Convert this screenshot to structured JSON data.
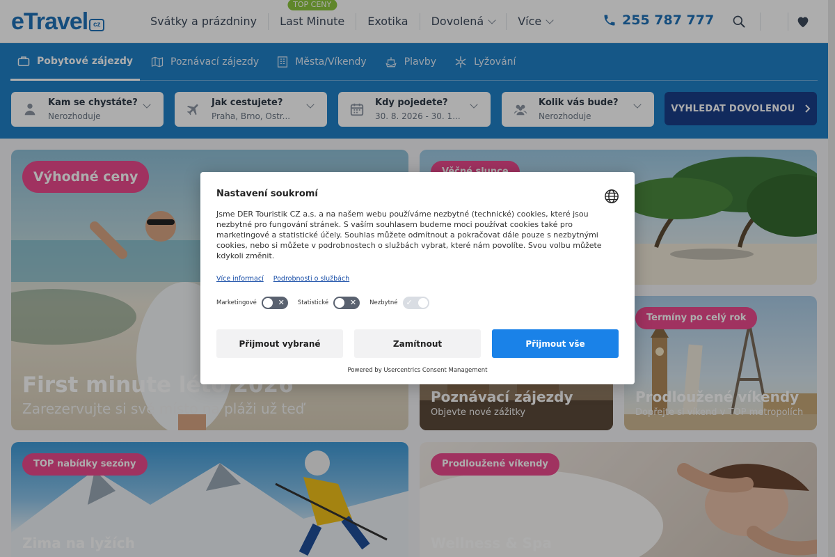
{
  "header": {
    "logo_text": "eTravel",
    "logo_suffix": "cz",
    "nav": [
      {
        "label": "Svátky a prázdniny"
      },
      {
        "label": "Last Minute",
        "badge": "TOP CENY"
      },
      {
        "label": "Exotika"
      },
      {
        "label": "Dovolená"
      },
      {
        "label": "Více"
      }
    ],
    "phone": "255 787 777",
    "icons": [
      "search-icon",
      "heart-icon"
    ]
  },
  "search_bar": {
    "tabs": [
      "Pobytové zájezdy",
      "Poznávací zájezdy",
      "Města/Víkendy",
      "Plavby",
      "Lyžování"
    ],
    "active_tab": "Pobytové zájezdy",
    "fields": [
      {
        "label": "Kam se chystáte?",
        "value": "Nerozhoduje"
      },
      {
        "label": "Jak cestujete?",
        "value": "Praha, Brno, Ostr..."
      },
      {
        "label": "Kdy pojedete?",
        "value": "30. 8. 2026 - 30. 1..."
      },
      {
        "label": "Kolik vás bude?",
        "value": "Nerozhoduje"
      }
    ],
    "search_button": "VYHLEDAT DOVOLENOU"
  },
  "tiles": [
    {
      "badge": "Výhodné ceny",
      "title": "First minute léto 2026",
      "subtitle": "Zarezervujte si své místo na pláži už teď"
    },
    {
      "badge": "Věčné slunce",
      "title": "",
      "subtitle": ""
    },
    {
      "badge": "",
      "title": "Poznávací zájezdy",
      "subtitle": "Objevte nové zážitky"
    },
    {
      "badge": "Termíny po celý rok",
      "title": "Prodloužené víkendy",
      "subtitle": "Dopřejte si víkend v TOP metropolích"
    },
    {
      "badge": "TOP nabídky sezóny",
      "title": "Zima na lyžích",
      "subtitle": ""
    },
    {
      "badge": "Prodloužené víkendy",
      "title": "Wellness & Spa",
      "subtitle": ""
    }
  ],
  "cookie_modal": {
    "title": "Nastavení soukromí",
    "text": "Jsme DER Touristik CZ a.s. a na našem webu používáme nezbytné (technické) cookies, které jsou nezbytné pro fungování stránek. S vaším souhlasem budeme moci používat cookies také pro marketingové a statistické účely. Souhlas můžete odmítnout a pokračovat dále pouze s nezbytnými cookies, nebo si můžete v podrobnostech o službách vybrat, které nám povolíte. Svou volbu můžete kdykoli změnit.",
    "links": [
      "Více informací",
      "Podrobnosti o službách"
    ],
    "toggles": [
      {
        "label": "Marketingové",
        "state": "off"
      },
      {
        "label": "Statistické",
        "state": "off"
      },
      {
        "label": "Nezbytné",
        "state": "on"
      }
    ],
    "buttons": {
      "accept_selected": "Přijmout vybrané",
      "reject": "Zamítnout",
      "accept_all": "Přijmout vše"
    },
    "powered_by": "Powered by Usercentrics Consent Management"
  }
}
